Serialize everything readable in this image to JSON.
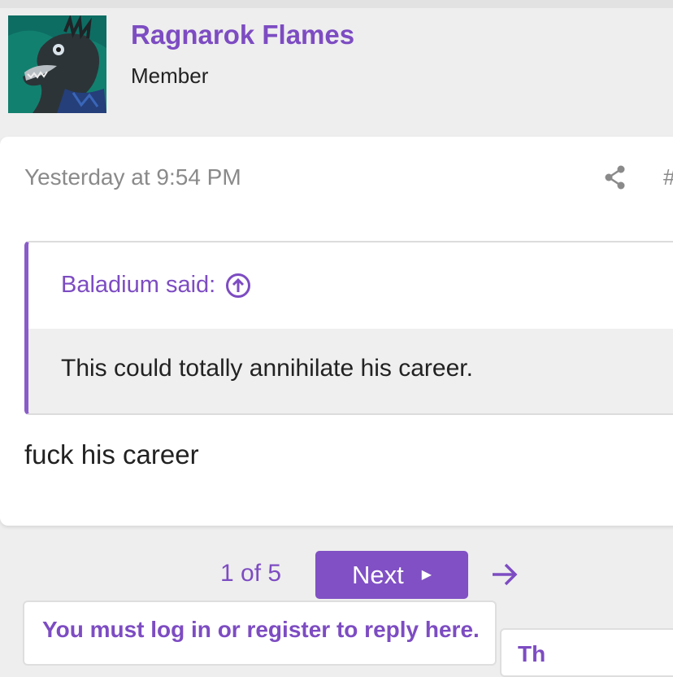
{
  "user": {
    "name": "Ragnarok Flames",
    "title": "Member",
    "avatar_icon": "creature-avatar"
  },
  "post": {
    "timestamp": "Yesterday at 9:54 PM",
    "share_icon": "share-icon",
    "permalink_label": "#",
    "quote": {
      "author_label": "Baladium said:",
      "jump_icon": "arrow-up-circle-icon",
      "text": "This could totally annihilate his career."
    },
    "body": "fuck his career"
  },
  "pagination": {
    "count": "1 of 5",
    "next_label": "Next",
    "next_icon": "caret-right-icon",
    "last_icon": "arrow-right-icon"
  },
  "reply_notice": "You must log in or register to reply here.",
  "side_widget_text": "Th",
  "colors": {
    "accent": "#7d4cc2",
    "button": "#8050c4",
    "background": "#eeeeee",
    "card": "#ffffff"
  }
}
